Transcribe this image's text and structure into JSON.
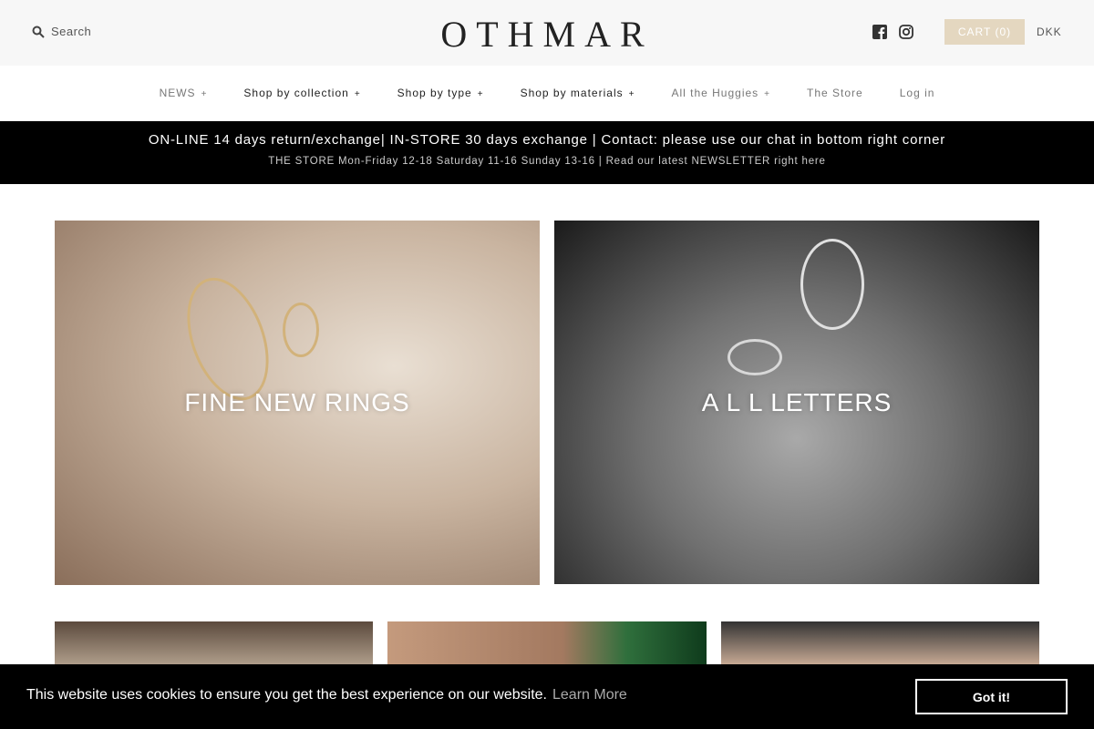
{
  "header": {
    "search_label": "Search",
    "logo": "OTHMAR",
    "cart_label": "CART (0)",
    "currency": "DKK",
    "icons": [
      "search-icon",
      "facebook-icon",
      "instagram-icon"
    ]
  },
  "nav": {
    "items": [
      {
        "label": "NEWS",
        "has_plus": true
      },
      {
        "label": "Shop by collection",
        "has_plus": true
      },
      {
        "label": "Shop by type",
        "has_plus": true
      },
      {
        "label": "Shop by materials",
        "has_plus": true
      },
      {
        "label": "All the Huggies",
        "has_plus": true
      },
      {
        "label": "The Store",
        "has_plus": false
      },
      {
        "label": "Log in",
        "has_plus": false
      }
    ],
    "plus": "+"
  },
  "banner": {
    "line1": "ON-LINE 14 days return/exchange| IN-STORE 30 days exchange | Contact: please use our chat in bottom right corner",
    "line2": "THE STORE Mon-Friday 12-18 Saturday 11-16 Sunday 13-16 | Read our latest NEWSLETTER right here"
  },
  "tiles": [
    {
      "title": "FINE NEW RINGS"
    },
    {
      "title": "A L L LETTERS"
    }
  ],
  "cookie": {
    "message": "This website uses cookies to ensure you get the best experience on our website.",
    "learn_more": "Learn More",
    "accept": "Got it!"
  },
  "colors": {
    "cart_bg": "#e4d7c0",
    "banner_bg": "#000000",
    "cookie_bg": "#000000"
  }
}
